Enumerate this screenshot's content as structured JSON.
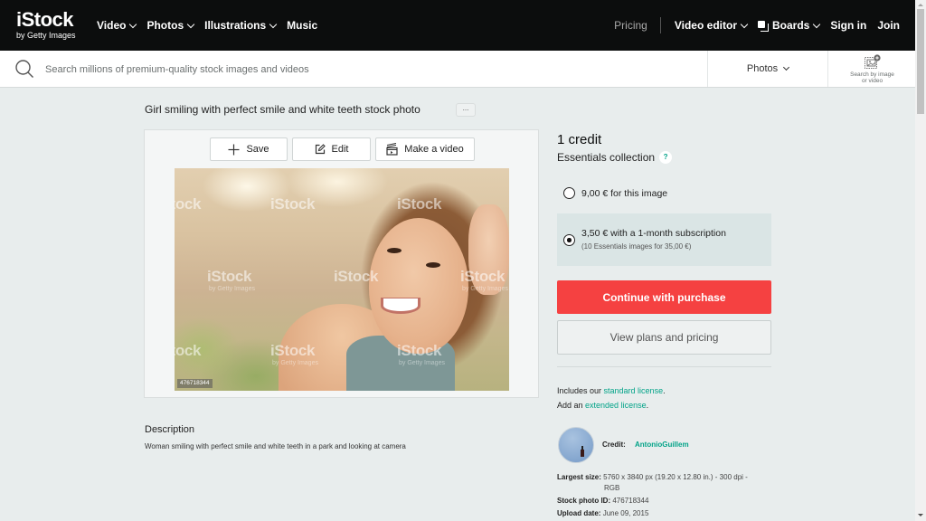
{
  "nav": {
    "logo_main": "iStock",
    "logo_sub": "by Getty Images",
    "items": [
      {
        "label": "Video",
        "dropdown": true
      },
      {
        "label": "Photos",
        "dropdown": true
      },
      {
        "label": "Illustrations",
        "dropdown": true
      },
      {
        "label": "Music",
        "dropdown": false
      }
    ],
    "pricing": "Pricing",
    "video_editor": "Video editor",
    "boards": "Boards",
    "sign_in": "Sign in",
    "join": "Join"
  },
  "search": {
    "placeholder": "Search millions of premium-quality stock images and videos",
    "value": "",
    "type_selected": "Photos",
    "search_by_image_line1": "Search by image",
    "search_by_image_line2": "or video"
  },
  "asset": {
    "title": "Girl smiling with perfect smile and white teeth stock photo",
    "more_label": "...",
    "actions": {
      "save": "Save",
      "edit": "Edit",
      "make_video": "Make a video"
    },
    "watermark": "iStock",
    "watermark_sub": "by Getty Images",
    "photo_id_tag": "476718344",
    "description_heading": "Description",
    "description": "Woman smiling with perfect smile and white teeth in a park and looking at camera"
  },
  "purchase": {
    "credits": "1 credit",
    "collection": "Essentials collection",
    "help_icon": "?",
    "options": [
      {
        "label": "9,00 € for this image",
        "sub": "",
        "selected": false
      },
      {
        "label": "3,50 € with a 1-month subscription",
        "sub": "(10 Essentials images for 35,00 €)",
        "selected": true
      }
    ],
    "continue_label": "Continue with purchase",
    "plans_label": "View plans and pricing",
    "license_line1_prefix": "Includes our ",
    "license_line1_link": "standard license",
    "license_line1_suffix": ".",
    "license_line2_prefix": "Add an ",
    "license_line2_link": "extended license",
    "license_line2_suffix": ".",
    "colors": {
      "accent_red": "#f54141",
      "link_green": "#02a388"
    }
  },
  "details": {
    "credit_label": "Credit:",
    "credit_name": "AntonioGuillem",
    "largest_size_label": "Largest size:",
    "largest_size_value": "5760 x 3840 px (19.20 x 12.80 in.) - 300 dpi -",
    "largest_size_value2": "RGB",
    "stock_id_label": "Stock photo ID:",
    "stock_id_value": "476718344",
    "upload_date_label": "Upload date:",
    "upload_date_value": "June 09, 2015"
  }
}
